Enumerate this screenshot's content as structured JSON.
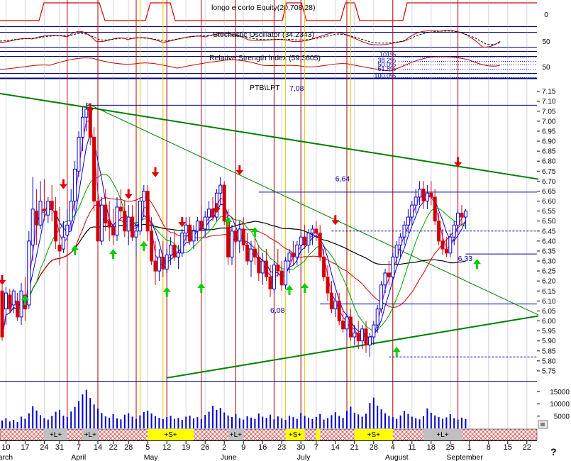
{
  "indicators": {
    "equity_label": "longo e corto Equity(20,708.28)",
    "equity_axis": "0",
    "stochastic_label": "Stochastic Oscillator (34.2343)",
    "stochastic_axis": "50",
    "rsi_label": "Relative Strength Index (59.3605)",
    "rsi_axis": "50",
    "fib_labels": [
      "101%",
      "38.2%",
      "50.0%",
      "61.8%",
      "100.0%"
    ]
  },
  "price_panel": {
    "ticker": "PTB\\LPT",
    "last_price": "7,08",
    "annotations": [
      {
        "text": "6,64",
        "x": 87,
        "y": 6.7
      },
      {
        "text": "6,08",
        "x": 70,
        "y": 6.04
      },
      {
        "text": "6,33",
        "x": 119,
        "y": 6.3
      }
    ],
    "colors": {
      "up_candle": "#0000d0",
      "down_candle": "#d00000",
      "ma_long": "#000000",
      "ma_mid": "#d00000",
      "ma_short": "#00a000",
      "ma_fast": "#0000d0",
      "ma_fastest": "#c000c0",
      "trend": "#008000",
      "levels": "#0000a8",
      "sell_arrow": "#e00000",
      "buy_arrow": "#00d000",
      "cycle_line": "#b00000",
      "alt_line": "#e8c800",
      "week_line": "#a0a0c8"
    }
  },
  "positions": [
    {
      "label": "+L+",
      "kind": "long"
    },
    {
      "label": "+L+",
      "kind": "long"
    },
    {
      "label": "+S+",
      "kind": "short"
    },
    {
      "label": "+L+",
      "kind": "long"
    },
    {
      "label": "+S+",
      "kind": "short"
    },
    {
      "label": "+S+",
      "kind": "short"
    },
    {
      "label": "+L+",
      "kind": "long"
    }
  ],
  "help_glyph": "?",
  "chart_data": {
    "type": "candlestick",
    "ylim": [
      5.7,
      7.17
    ],
    "y_ticks": [
      "7.15",
      "7.10",
      "7.05",
      "7.00",
      "6.95",
      "6.90",
      "6.85",
      "6.80",
      "6.75",
      "6.70",
      "6.65",
      "6.60",
      "6.55",
      "6.50",
      "6.45",
      "6.40",
      "6.35",
      "6.30",
      "6.25",
      "6.20",
      "6.15",
      "6.10",
      "6.05",
      "6.00",
      "5.95",
      "5.90",
      "5.85",
      "5.80",
      "5.75"
    ],
    "volume_ticks": [
      "15000",
      "10000",
      "5000"
    ],
    "volume_ylim": [
      0,
      18000
    ],
    "x_day_labels": [
      {
        "x": 1,
        "label": "10"
      },
      {
        "x": 6,
        "label": "17"
      },
      {
        "x": 11,
        "label": "24"
      },
      {
        "x": 15,
        "label": "31"
      },
      {
        "x": 20,
        "label": "7"
      },
      {
        "x": 25,
        "label": "14"
      },
      {
        "x": 29,
        "label": "22"
      },
      {
        "x": 33,
        "label": "28"
      },
      {
        "x": 38,
        "label": "5"
      },
      {
        "x": 43,
        "label": "12"
      },
      {
        "x": 48,
        "label": "19"
      },
      {
        "x": 53,
        "label": "26"
      },
      {
        "x": 58,
        "label": "2"
      },
      {
        "x": 63,
        "label": "9"
      },
      {
        "x": 68,
        "label": "16"
      },
      {
        "x": 73,
        "label": "23"
      },
      {
        "x": 78,
        "label": "30"
      },
      {
        "x": 82,
        "label": "7"
      },
      {
        "x": 87,
        "label": "14"
      },
      {
        "x": 92,
        "label": "21"
      },
      {
        "x": 97,
        "label": "28"
      },
      {
        "x": 102,
        "label": "4"
      },
      {
        "x": 107,
        "label": "11"
      },
      {
        "x": 112,
        "label": "18"
      },
      {
        "x": 117,
        "label": "25"
      },
      {
        "x": 122,
        "label": "1"
      },
      {
        "x": 127,
        "label": "8"
      },
      {
        "x": 132,
        "label": "15"
      },
      {
        "x": 137,
        "label": "22"
      }
    ],
    "x_month_labels": [
      {
        "x": -1,
        "label": "arch"
      },
      {
        "x": 18,
        "label": "April"
      },
      {
        "x": 37,
        "label": "May"
      },
      {
        "x": 57,
        "label": "June"
      },
      {
        "x": 77,
        "label": "July"
      },
      {
        "x": 100,
        "label": "August"
      },
      {
        "x": 116,
        "label": "September"
      }
    ],
    "cycle_lines": [
      17,
      25,
      35,
      43,
      52,
      61,
      71,
      78,
      90,
      102,
      119
    ],
    "alt_lines": [
      36,
      42,
      74,
      79,
      91
    ],
    "levels": [
      {
        "y": 7.08,
        "x0": 22,
        "x1": 140
      },
      {
        "y": 6.645,
        "x0": 67,
        "x1": 140
      },
      {
        "y": 6.45,
        "x0": 86,
        "x1": 140,
        "dashed": true
      },
      {
        "y": 6.335,
        "x0": 121,
        "x1": 140
      },
      {
        "y": 6.085,
        "x0": 83,
        "x1": 140
      },
      {
        "y": 5.82,
        "x0": 101,
        "x1": 140,
        "dashed": true
      }
    ],
    "trendlines": [
      {
        "x0": -1,
        "y0": 7.14,
        "x1": 140,
        "y1": 6.71,
        "width": 2
      },
      {
        "x0": 43,
        "y0": 5.715,
        "x1": 140,
        "y1": 6.025,
        "width": 2
      },
      {
        "x0": 22,
        "y0": 7.09,
        "x1": 140,
        "y1": 6.03,
        "width": 1
      }
    ],
    "sell_signals": [
      [
        0,
        6.18
      ],
      [
        16,
        6.66
      ],
      [
        23,
        7.04
      ],
      [
        33,
        6.61
      ],
      [
        40,
        6.72
      ],
      [
        47,
        6.47
      ],
      [
        56,
        6.54
      ],
      [
        62,
        6.73
      ],
      [
        87,
        6.48
      ],
      [
        119,
        6.77
      ]
    ],
    "buy_signals": [
      [
        6,
        6.13
      ],
      [
        19,
        6.38
      ],
      [
        29,
        6.36
      ],
      [
        37,
        6.4
      ],
      [
        43,
        6.17
      ],
      [
        52,
        6.19
      ],
      [
        59,
        6.52
      ],
      [
        66,
        6.47
      ],
      [
        75,
        6.18
      ],
      [
        79,
        6.19
      ],
      [
        103,
        5.87
      ],
      [
        124,
        6.31
      ]
    ],
    "candles": [
      [
        6.15,
        6.18,
        5.9,
        5.92
      ],
      [
        6.06,
        6.17,
        5.98,
        6.14
      ],
      [
        6.13,
        6.16,
        6.04,
        6.06
      ],
      [
        6.08,
        6.16,
        6.04,
        6.15
      ],
      [
        6.1,
        6.14,
        6.0,
        6.02
      ],
      [
        6.02,
        6.19,
        5.98,
        6.15
      ],
      [
        6.13,
        6.22,
        6.0,
        6.06
      ],
      [
        6.08,
        6.45,
        6.06,
        6.4
      ],
      [
        6.38,
        6.72,
        6.3,
        6.56
      ],
      [
        6.55,
        6.66,
        6.38,
        6.48
      ],
      [
        6.48,
        6.7,
        6.46,
        6.6
      ],
      [
        6.56,
        6.71,
        6.5,
        6.55
      ],
      [
        6.53,
        6.62,
        6.49,
        6.6
      ],
      [
        6.6,
        6.68,
        6.5,
        6.56
      ],
      [
        6.55,
        6.62,
        6.36,
        6.4
      ],
      [
        6.38,
        6.57,
        6.28,
        6.35
      ],
      [
        6.36,
        6.5,
        6.34,
        6.42
      ],
      [
        6.43,
        6.56,
        6.4,
        6.48
      ],
      [
        6.5,
        6.66,
        6.45,
        6.6
      ],
      [
        6.6,
        6.8,
        6.55,
        6.76
      ],
      [
        6.75,
        6.95,
        6.72,
        6.92
      ],
      [
        6.92,
        7.07,
        6.85,
        7.02
      ],
      [
        7.02,
        7.09,
        6.95,
        7.06
      ],
      [
        7.05,
        7.08,
        6.88,
        6.92
      ],
      [
        6.92,
        6.97,
        6.55,
        6.6
      ],
      [
        6.6,
        6.72,
        6.35,
        6.4
      ],
      [
        6.4,
        6.62,
        6.38,
        6.58
      ],
      [
        6.58,
        6.66,
        6.45,
        6.49
      ],
      [
        6.5,
        6.6,
        6.4,
        6.47
      ],
      [
        6.47,
        6.56,
        6.38,
        6.43
      ],
      [
        6.43,
        6.62,
        6.4,
        6.57
      ],
      [
        6.57,
        6.66,
        6.5,
        6.55
      ],
      [
        6.55,
        6.6,
        6.42,
        6.45
      ],
      [
        6.45,
        6.58,
        6.38,
        6.52
      ],
      [
        6.52,
        6.58,
        6.4,
        6.42
      ],
      [
        6.42,
        6.5,
        6.32,
        6.45
      ],
      [
        6.45,
        6.62,
        6.43,
        6.6
      ],
      [
        6.6,
        6.68,
        6.52,
        6.65
      ],
      [
        6.65,
        6.68,
        6.4,
        6.45
      ],
      [
        6.45,
        6.52,
        6.28,
        6.3
      ],
      [
        6.3,
        6.4,
        6.18,
        6.25
      ],
      [
        6.25,
        6.36,
        6.2,
        6.32
      ],
      [
        6.32,
        6.4,
        6.22,
        6.26
      ],
      [
        6.26,
        6.36,
        6.24,
        6.33
      ],
      [
        6.33,
        6.42,
        6.28,
        6.38
      ],
      [
        6.38,
        6.45,
        6.3,
        6.32
      ],
      [
        6.32,
        6.38,
        6.26,
        6.34
      ],
      [
        6.34,
        6.46,
        6.32,
        6.44
      ],
      [
        6.44,
        6.52,
        6.4,
        6.48
      ],
      [
        6.48,
        6.52,
        6.38,
        6.4
      ],
      [
        6.4,
        6.48,
        6.36,
        6.45
      ],
      [
        6.45,
        6.52,
        6.4,
        6.5
      ],
      [
        6.5,
        6.58,
        6.44,
        6.46
      ],
      [
        6.46,
        6.55,
        6.42,
        6.52
      ],
      [
        6.52,
        6.6,
        6.46,
        6.56
      ],
      [
        6.56,
        6.62,
        6.5,
        6.52
      ],
      [
        6.52,
        6.66,
        6.5,
        6.64
      ],
      [
        6.64,
        6.72,
        6.58,
        6.68
      ],
      [
        6.68,
        6.7,
        6.48,
        6.5
      ],
      [
        6.5,
        6.56,
        6.28,
        6.32
      ],
      [
        6.32,
        6.48,
        6.28,
        6.45
      ],
      [
        6.45,
        6.52,
        6.36,
        6.4
      ],
      [
        6.4,
        6.5,
        6.34,
        6.46
      ],
      [
        6.46,
        6.52,
        6.35,
        6.38
      ],
      [
        6.38,
        6.44,
        6.28,
        6.3
      ],
      [
        6.3,
        6.4,
        6.22,
        6.36
      ],
      [
        6.36,
        6.42,
        6.28,
        6.32
      ],
      [
        6.32,
        6.38,
        6.2,
        6.24
      ],
      [
        6.24,
        6.34,
        6.18,
        6.3
      ],
      [
        6.3,
        6.36,
        6.2,
        6.22
      ],
      [
        6.22,
        6.28,
        6.12,
        6.16
      ],
      [
        6.16,
        6.3,
        6.14,
        6.28
      ],
      [
        6.28,
        6.36,
        6.22,
        6.25
      ],
      [
        6.25,
        6.3,
        6.15,
        6.18
      ],
      [
        6.18,
        6.32,
        6.16,
        6.3
      ],
      [
        6.3,
        6.36,
        6.24,
        6.34
      ],
      [
        6.34,
        6.4,
        6.28,
        6.32
      ],
      [
        6.32,
        6.4,
        6.28,
        6.38
      ],
      [
        6.38,
        6.44,
        6.34,
        6.42
      ],
      [
        6.42,
        6.48,
        6.36,
        6.38
      ],
      [
        6.38,
        6.46,
        6.34,
        6.44
      ],
      [
        6.44,
        6.48,
        6.38,
        6.46
      ],
      [
        6.46,
        6.5,
        6.4,
        6.44
      ],
      [
        6.44,
        6.48,
        6.3,
        6.32
      ],
      [
        6.32,
        6.36,
        6.2,
        6.22
      ],
      [
        6.22,
        6.28,
        6.1,
        6.14
      ],
      [
        6.14,
        6.2,
        6.04,
        6.06
      ],
      [
        6.06,
        6.14,
        6.02,
        6.1
      ],
      [
        6.1,
        6.14,
        5.98,
        6.0
      ],
      [
        6.0,
        6.06,
        5.94,
        5.96
      ],
      [
        5.96,
        6.04,
        5.92,
        6.02
      ],
      [
        6.02,
        6.06,
        5.9,
        5.92
      ],
      [
        5.92,
        5.98,
        5.88,
        5.94
      ],
      [
        5.94,
        6.0,
        5.86,
        5.9
      ],
      [
        5.9,
        5.98,
        5.86,
        5.96
      ],
      [
        5.96,
        6.0,
        5.84,
        5.88
      ],
      [
        5.88,
        5.94,
        5.82,
        5.92
      ],
      [
        5.92,
        6.0,
        5.88,
        5.98
      ],
      [
        5.98,
        6.08,
        5.94,
        6.06
      ],
      [
        6.06,
        6.2,
        6.04,
        6.18
      ],
      [
        6.18,
        6.26,
        6.14,
        6.24
      ],
      [
        6.24,
        6.3,
        6.18,
        6.22
      ],
      [
        6.22,
        6.34,
        6.2,
        6.32
      ],
      [
        6.32,
        6.4,
        6.28,
        6.38
      ],
      [
        6.38,
        6.44,
        6.32,
        6.42
      ],
      [
        6.42,
        6.5,
        6.38,
        6.48
      ],
      [
        6.48,
        6.56,
        6.44,
        6.52
      ],
      [
        6.52,
        6.6,
        6.48,
        6.58
      ],
      [
        6.58,
        6.66,
        6.54,
        6.62
      ],
      [
        6.62,
        6.7,
        6.58,
        6.66
      ],
      [
        6.66,
        6.7,
        6.56,
        6.6
      ],
      [
        6.6,
        6.68,
        6.56,
        6.64
      ],
      [
        6.64,
        6.7,
        6.58,
        6.62
      ],
      [
        6.62,
        6.66,
        6.48,
        6.5
      ],
      [
        6.5,
        6.54,
        6.38,
        6.4
      ],
      [
        6.4,
        6.46,
        6.33,
        6.36
      ],
      [
        6.36,
        6.42,
        6.32,
        6.34
      ],
      [
        6.34,
        6.44,
        6.32,
        6.42
      ],
      [
        6.42,
        6.5,
        6.38,
        6.48
      ],
      [
        6.48,
        6.56,
        6.44,
        6.54
      ],
      [
        6.54,
        6.58,
        6.48,
        6.52
      ],
      [
        6.52,
        6.56,
        6.46,
        6.55
      ]
    ],
    "volumes": [
      3200,
      4100,
      2800,
      3500,
      2600,
      4800,
      3900,
      6200,
      9100,
      7300,
      5400,
      4200,
      3600,
      5100,
      6800,
      7600,
      5200,
      4700,
      6900,
      8800,
      11200,
      13900,
      15800,
      12400,
      9800,
      8100,
      6300,
      4900,
      4400,
      5800,
      4100,
      3700,
      5600,
      6200,
      4800,
      3900,
      5300,
      6700,
      7200,
      6100,
      5000,
      4300,
      3800,
      4600,
      5100,
      3900,
      4200,
      3500,
      4800,
      5200,
      4100,
      4600,
      3800,
      5500,
      6800,
      9200,
      7600,
      8400,
      6500,
      5300,
      4700,
      5900,
      4200,
      3600,
      5000,
      4400,
      3900,
      6100,
      4800,
      4300,
      5600,
      3700,
      4900,
      4100,
      3500,
      5200,
      4600,
      3900,
      6300,
      5100,
      4400,
      3800,
      4700,
      5900,
      3600,
      4200,
      5400,
      6600,
      5100,
      4300,
      7200,
      8900,
      6400,
      5700,
      4800,
      6000,
      10400,
      12600,
      9300,
      7800,
      6200,
      5100,
      4600,
      3900,
      5300,
      7100,
      5900,
      4800,
      4200,
      3700,
      5000,
      8200,
      6400,
      5300,
      4700,
      3900,
      4500,
      5800,
      4200,
      3600,
      4400,
      3800
    ]
  }
}
